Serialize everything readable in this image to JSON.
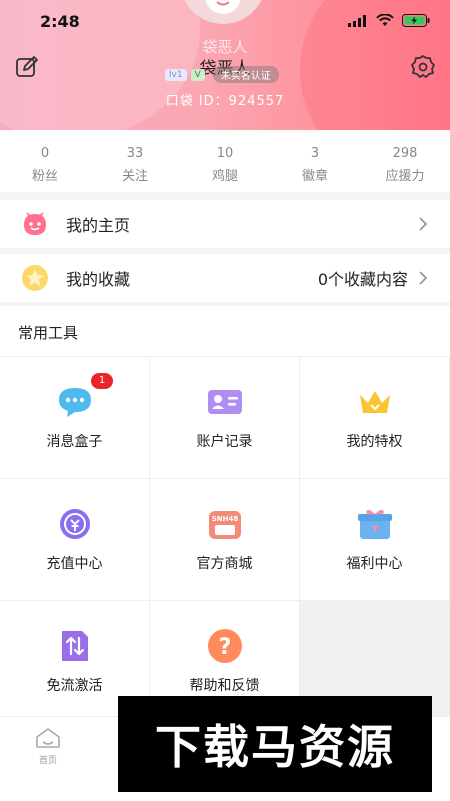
{
  "status_bar": {
    "time": "2:48"
  },
  "profile": {
    "nickname_faded": "袋恶人",
    "nickname": "袋恶人",
    "level": "lv1",
    "vip": "V",
    "auth_label": "未实名认证",
    "pocket_id": "口袋 ID：924557"
  },
  "stats": [
    {
      "value": "0",
      "label": "粉丝"
    },
    {
      "value": "33",
      "label": "关注"
    },
    {
      "value": "10",
      "label": "鸡腿"
    },
    {
      "value": "3",
      "label": "徽章"
    },
    {
      "value": "298",
      "label": "应援力"
    }
  ],
  "menu": {
    "homepage": {
      "label": "我的主页"
    },
    "favorites": {
      "label": "我的收藏",
      "value": "0个收藏内容"
    }
  },
  "tools": {
    "title": "常用工具",
    "items": [
      {
        "label": "消息盒子",
        "icon": "message-icon",
        "badge": "1"
      },
      {
        "label": "账户记录",
        "icon": "id-card-icon"
      },
      {
        "label": "我的特权",
        "icon": "crown-icon"
      },
      {
        "label": "充值中心",
        "icon": "recharge-icon"
      },
      {
        "label": "官方商城",
        "icon": "shop-icon",
        "icon_text": "SNH48"
      },
      {
        "label": "福利中心",
        "icon": "gift-icon"
      },
      {
        "label": "免流激活",
        "icon": "data-free-icon"
      },
      {
        "label": "帮助和反馈",
        "icon": "help-icon",
        "icon_text": "?"
      }
    ]
  },
  "tabbar": {
    "home_label": "首页"
  },
  "watermark": {
    "text": "下载马资源"
  },
  "colors": {
    "accent": "#ff8d96",
    "badge": "#e8262a"
  }
}
